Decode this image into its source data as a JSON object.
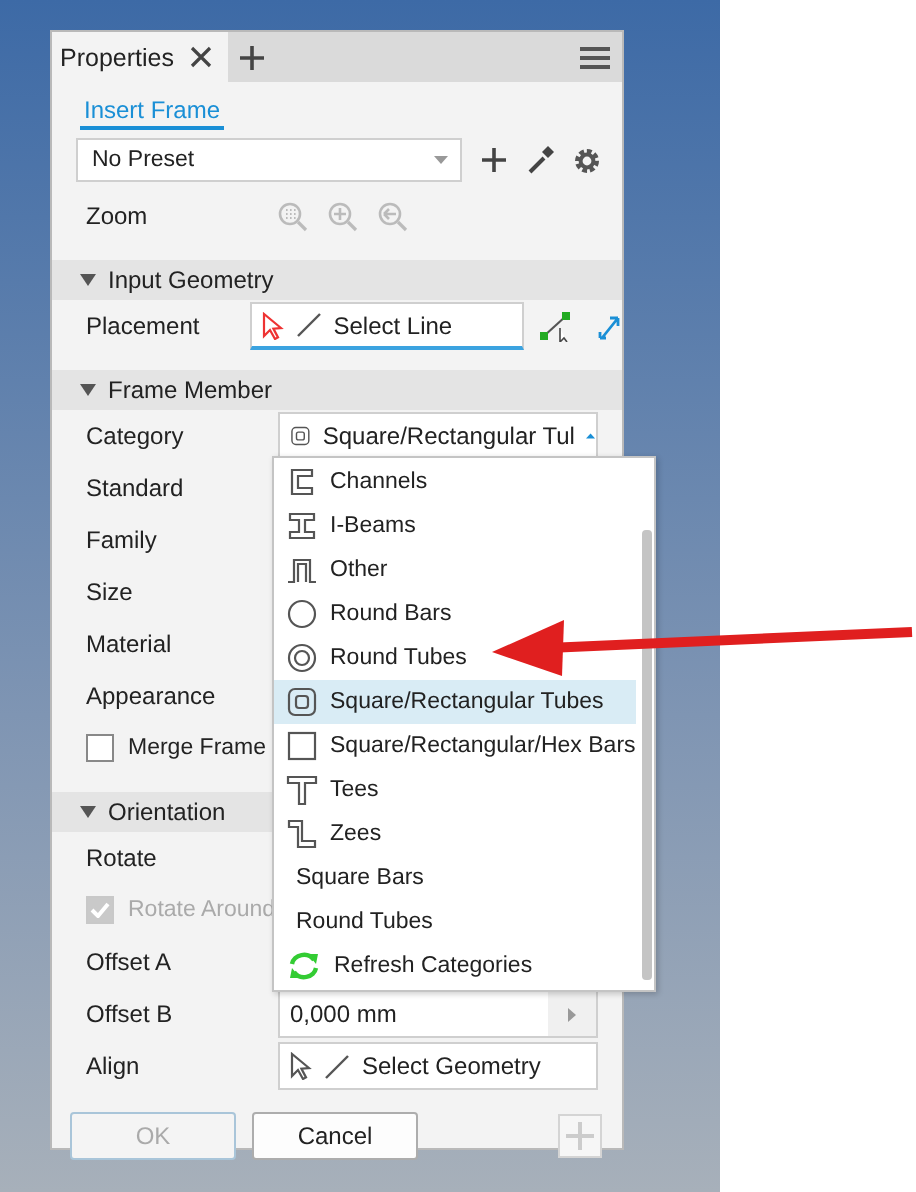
{
  "tab": {
    "label": "Properties",
    "selected": true
  },
  "link": "Insert Frame",
  "preset": "No Preset",
  "zoom_label": "Zoom",
  "sections": [
    {
      "title": "Input Geometry",
      "expanded": true,
      "rows": [
        {
          "kind": "select",
          "label": "Placement",
          "value": "Select Line",
          "active": true
        }
      ]
    },
    {
      "title": "Frame Member",
      "expanded": true,
      "rows": [
        {
          "kind": "dropdown",
          "label": "Category",
          "value": "Square/Rectangular Tul",
          "open": true
        },
        {
          "kind": "label",
          "label": "Standard"
        },
        {
          "kind": "label",
          "label": "Family"
        },
        {
          "kind": "label",
          "label": "Size"
        },
        {
          "kind": "label",
          "label": "Material"
        },
        {
          "kind": "label",
          "label": "Appearance"
        },
        {
          "kind": "checkbox",
          "label": "Merge Frame",
          "checked": false,
          "disabled": false
        }
      ]
    },
    {
      "title": "Orientation",
      "expanded": true,
      "rows": [
        {
          "kind": "label",
          "label": "Rotate"
        },
        {
          "kind": "checkbox",
          "label": "Rotate Around",
          "checked": true,
          "disabled": true
        },
        {
          "kind": "label",
          "label": "Offset A"
        },
        {
          "kind": "number",
          "label": "Offset B",
          "value": "0,000 mm"
        },
        {
          "kind": "select",
          "label": "Align",
          "value": "Select Geometry",
          "active": false
        }
      ]
    }
  ],
  "buttons": [
    {
      "label": "OK",
      "disabled": true
    },
    {
      "label": "Cancel",
      "disabled": false
    }
  ],
  "category_menu": [
    {
      "kind": "channel",
      "label": "Channels",
      "selected": false
    },
    {
      "kind": "ibeam",
      "label": "I-Beams",
      "selected": false
    },
    {
      "kind": "other",
      "label": "Other",
      "selected": false
    },
    {
      "kind": "round-bar",
      "label": "Round Bars",
      "selected": false
    },
    {
      "kind": "round-tube",
      "label": "Round Tubes",
      "selected": false
    },
    {
      "kind": "square-tube",
      "label": "Square/Rectangular Tubes",
      "selected": true
    },
    {
      "kind": "square-bar",
      "label": "Square/Rectangular/Hex Bars",
      "selected": false
    },
    {
      "kind": "tee",
      "label": "Tees",
      "selected": false
    },
    {
      "kind": "zee",
      "label": "Zees",
      "selected": false
    },
    {
      "kind": "plain",
      "label": "Square Bars",
      "selected": false
    },
    {
      "kind": "plain",
      "label": "Round Tubes",
      "selected": false
    },
    {
      "kind": "refresh",
      "label": "Refresh Categories",
      "selected": false
    }
  ]
}
